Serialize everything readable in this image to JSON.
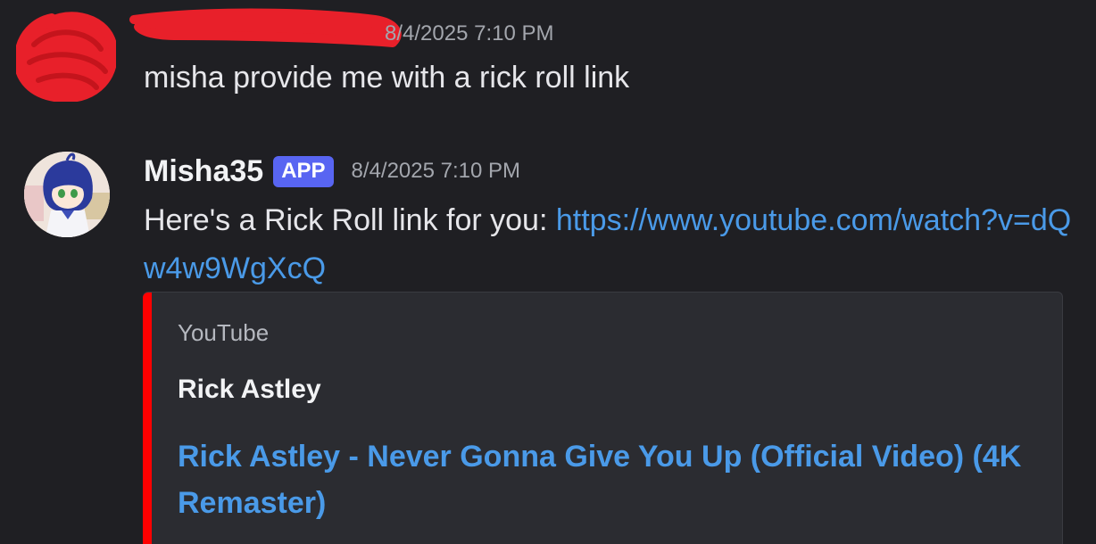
{
  "messages": [
    {
      "author": "",
      "timestamp": "8/4/2025 7:10 PM",
      "content": "misha provide me with a rick roll link"
    },
    {
      "author": "Misha35",
      "badge": "APP",
      "timestamp": "8/4/2025 7:10 PM",
      "content_prefix": "Here's a Rick Roll link for you: ",
      "link": "https://www.youtube.com/watch?v=dQw4w9WgXcQ",
      "embed": {
        "provider": "YouTube",
        "author": "Rick Astley",
        "title": "Rick Astley - Never Gonna Give You Up (Official Video) (4K Remaster)",
        "accent_color": "#ff0000"
      }
    }
  ],
  "colors": {
    "background": "#1f1f23",
    "text": "#e6e6ea",
    "muted": "#a3a6ad",
    "link": "#4a9ae8",
    "badge": "#5865f2",
    "redaction": "#e8202a"
  }
}
